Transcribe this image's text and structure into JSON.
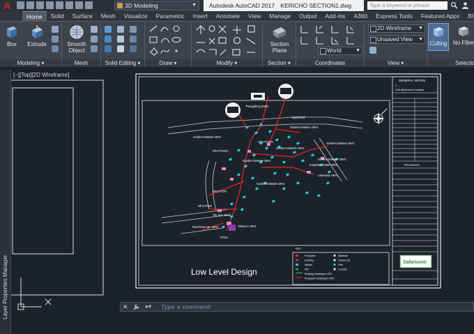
{
  "titlebar": {
    "app_logo": "A",
    "workspace": "3D Modeling",
    "app_title": "Autodesk AutoCAD 2017",
    "file_name": "KERICHO SECTION1.dwg",
    "search_placeholder": "Type a keyword or phrase"
  },
  "ribbon_tabs": [
    "Home",
    "Solid",
    "Surface",
    "Mesh",
    "Visualize",
    "Parametric",
    "Insert",
    "Annotate",
    "View",
    "Manage",
    "Output",
    "Add-ins",
    "A360",
    "Express Tools",
    "Featured Apps",
    "BI"
  ],
  "ribbon": {
    "buttons": {
      "box": "Box",
      "extrude": "Extrude",
      "smooth_object_line1": "Smooth",
      "smooth_object_line2": "Object",
      "section_plane_line1": "Section",
      "section_plane_line2": "Plane",
      "culling": "Culling",
      "no_filter": "No Filter"
    },
    "groups": {
      "modeling": "Modeling ▾",
      "mesh": "Mesh",
      "solid_editing": "Solid Editing ▾",
      "draw": "Draw ▾",
      "modify": "Modify ▾",
      "section": "Section ▾",
      "coordinates": "Coordinates",
      "view": "View ▾",
      "selection": "Selection"
    },
    "dropdowns": {
      "visual_style": "2D Wireframe",
      "view_saved": "Unsaved View",
      "ucs": "World"
    }
  },
  "viewport_label": "[−][Top][2D Wireframe]",
  "palette_title": "Layer Properties Manager",
  "command_line": {
    "placeholder": "Type a command"
  },
  "drawing": {
    "caption": "Low Level Design",
    "title_block": {
      "general_notes": "GENERAL NOTES",
      "note_1": "1. ...",
      "note_2": "2.All dimensions in metres",
      "revisions": "REVISIONS",
      "company": "Safaricom"
    },
    "map_labels": {
      "vipingo": "Vipindi Rd",
      "thamiri": "Thangithing 300m",
      "garden_estate_1": "Garden Estate1-19H1",
      "garden_estate_2": "Garden Estate2-19H1",
      "garden_estate_3": "Garden Estate3-19H1",
      "garden_estate_4": "Garden Estate4-19H1",
      "garden_estate_5": "Garden Estate5-19H1",
      "garden_estate_6": "Garden Estate6-19H1",
      "garden_estate_7": "Garden Estate7-19H1",
      "splitter_1": "SPLITTER1",
      "splitter_2": "SPLITTER1",
      "splitter_3": "SPLITTER",
      "splitter_4": "SPLITTER",
      "riverfront": "Riverfront Apt. 19H1",
      "lakeview": "Lakeview 19H1",
      "tile": "Tile Apt. 19H1",
      "tobacco": "Tobacco 19H1",
      "kingdom": "Kingdom Estate 19H1",
      "kfsc": "KFSC"
    },
    "legend": {
      "key": "KEY",
      "items": [
        "Proposed",
        "Existing",
        "Splitter",
        "FAT",
        "Existing Underlayer OFC",
        "Proposed Underlayer OFC"
      ],
      "items_right": [
        "Manhole",
        "Closure kit",
        "Pole",
        "Conduit"
      ]
    }
  },
  "colors": {
    "canvas": "#1c2229",
    "route": "#e3242b",
    "node": "#1fd0d8",
    "autocad_red": "#d9251c"
  }
}
